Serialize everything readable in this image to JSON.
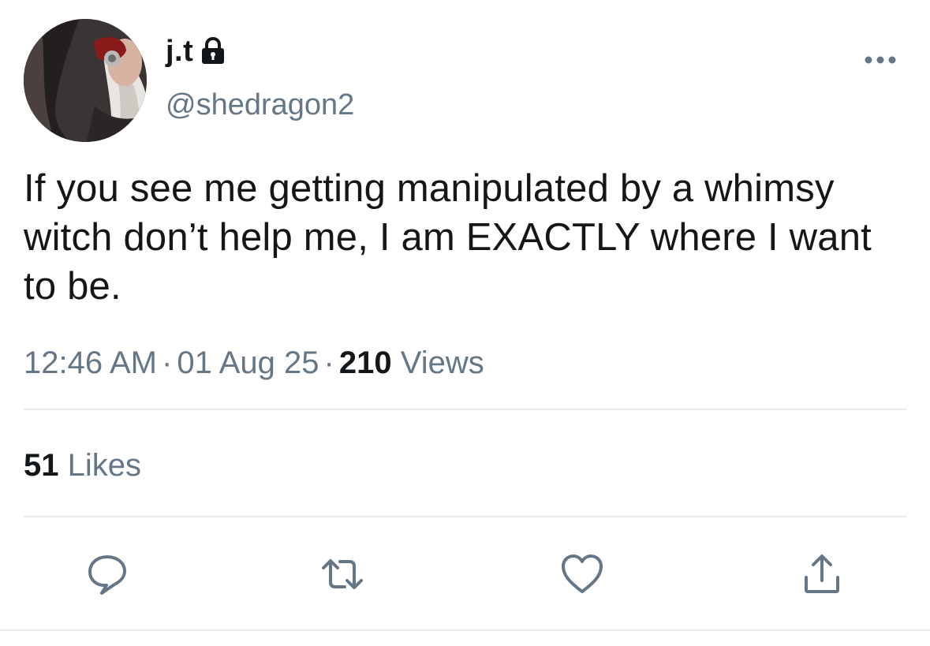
{
  "user": {
    "display_name": "j.t",
    "handle": "@shedragon2",
    "avatar": "avatar-photo",
    "protected_icon": "lock-icon"
  },
  "menu_icon": "more-horizontal-icon",
  "tweet": {
    "text": "If you see me getting manipulated by a whimsy witch don’t help me, I am EXACTLY where I want to be.",
    "time": "12:46 AM",
    "separator": "·",
    "date": "01 Aug 25",
    "views_count": "210",
    "views_label": "Views"
  },
  "stats": {
    "likes_count": "51",
    "likes_label": "Likes"
  },
  "actions": {
    "reply_icon": "reply-icon",
    "retweet_icon": "retweet-icon",
    "like_icon": "heart-icon",
    "share_icon": "share-icon"
  },
  "colors": {
    "text_primary": "#14171a",
    "text_secondary": "#657786",
    "icon": "#657786",
    "divider": "#e6ecf0",
    "background": "#ffffff"
  }
}
